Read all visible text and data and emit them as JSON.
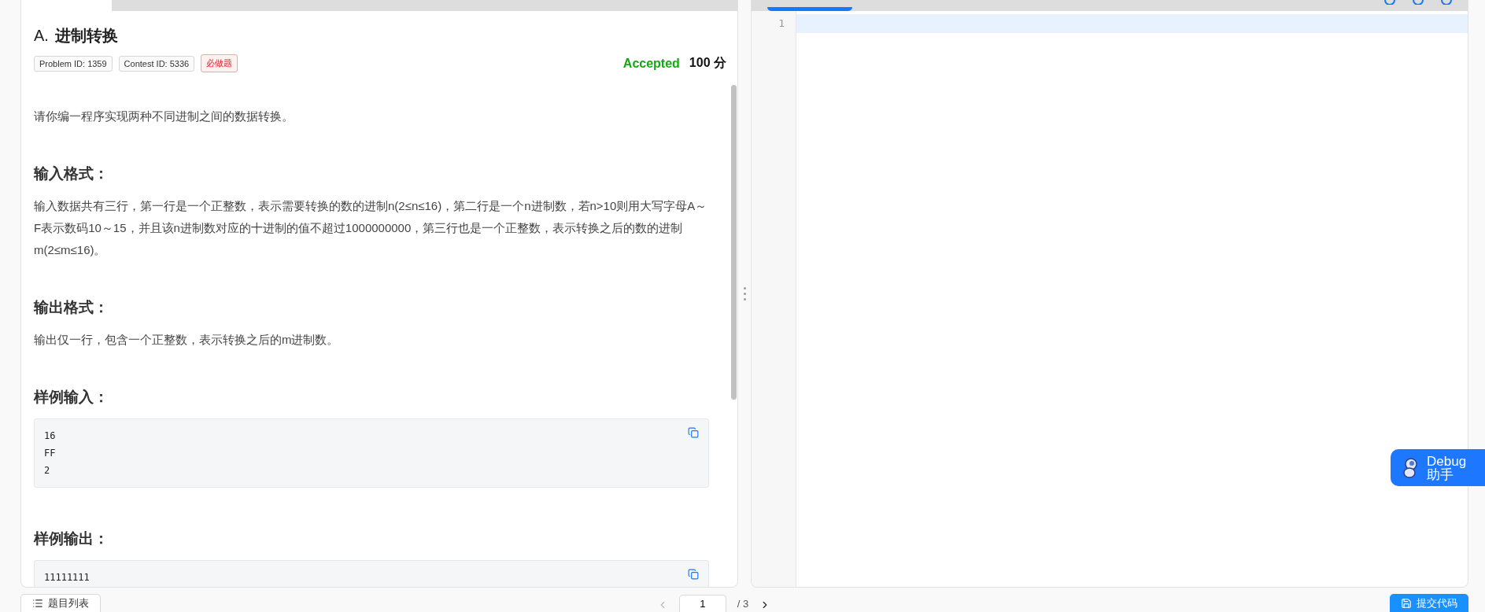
{
  "problem": {
    "index": "A.",
    "title": "进制转换",
    "tags": [
      {
        "label": "Problem ID: 1359",
        "kind": "plain"
      },
      {
        "label": "Contest ID: 5336",
        "kind": "plain"
      },
      {
        "label": "必做题",
        "kind": "required"
      }
    ],
    "status": "Accepted",
    "score": "100 分",
    "sections": [
      {
        "kind": "paragraph",
        "text": "请你编一程序实现两种不同进制之间的数据转换。"
      },
      {
        "kind": "heading",
        "text": "输入格式："
      },
      {
        "kind": "paragraph",
        "text": "输入数据共有三行，第一行是一个正整数，表示需要转换的数的进制n(2≤n≤16)，第二行是一个n进制数，若n>10则用大写字母A～F表示数码10～15，并且该n进制数对应的十进制的值不超过1000000000，第三行也是一个正整数，表示转换之后的数的进制m(2≤m≤16)。"
      },
      {
        "kind": "heading",
        "text": "输出格式："
      },
      {
        "kind": "paragraph",
        "text": "输出仅一行，包含一个正整数，表示转换之后的m进制数。"
      },
      {
        "kind": "heading",
        "text": "样例输入："
      },
      {
        "kind": "code",
        "lines": [
          "16",
          "FF",
          "2"
        ]
      },
      {
        "kind": "heading",
        "text": "样例输出："
      },
      {
        "kind": "code",
        "lines": [
          "11111111"
        ]
      }
    ]
  },
  "editor": {
    "line_numbers": [
      "1"
    ]
  },
  "debug": {
    "lines": [
      "Debug",
      "助手"
    ]
  },
  "footer": {
    "list_button": "题目列表",
    "page": "1",
    "total": "/ 3",
    "prev_disabled": true,
    "next_disabled": false,
    "submit": "提交代码"
  }
}
